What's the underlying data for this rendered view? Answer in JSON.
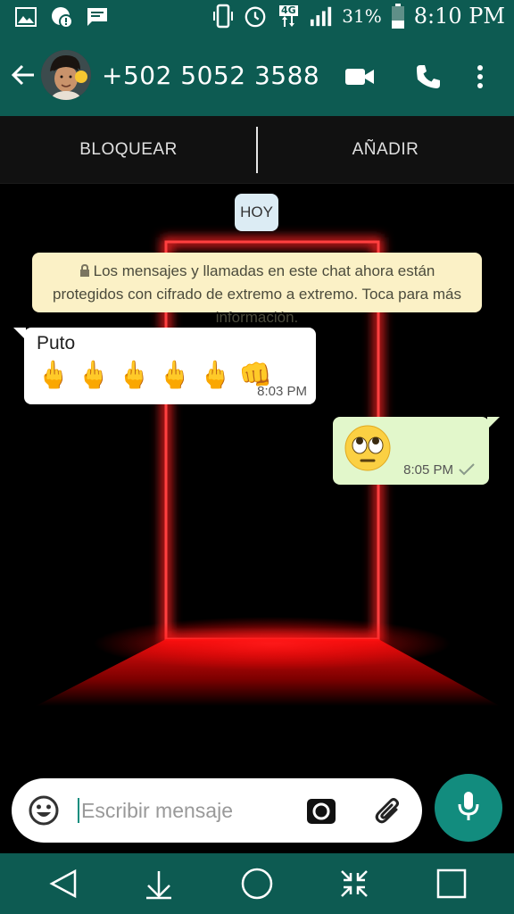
{
  "status_bar": {
    "network": "4G",
    "battery_percent": "31%",
    "time": "8:10 PM"
  },
  "header": {
    "contact_name": "+502 5052 3588",
    "back_icon": "arrow-left-icon",
    "video_icon": "videocam-icon",
    "call_icon": "phone-icon",
    "menu_icon": "more-vert-icon"
  },
  "actions": {
    "block_label": "BLOQUEAR",
    "add_label": "AÑADIR"
  },
  "chat": {
    "day_label": "HOY",
    "encryption_notice": "Los mensajes y llamadas en este chat ahora están protegidos con cifrado de extremo a extremo. Toca para más información.",
    "messages": [
      {
        "direction": "incoming",
        "text": "Puto",
        "emojis": [
          "🖕",
          "🖕",
          "🖕",
          "🖕",
          "🖕",
          "👊"
        ],
        "time": "8:03 PM"
      },
      {
        "direction": "outgoing",
        "emoji": "🙄",
        "time": "8:05 PM",
        "status": "sent"
      }
    ]
  },
  "composer": {
    "placeholder": "Escribir mensaje"
  },
  "colors": {
    "primary": "#0d5b52",
    "accent": "#128c7e",
    "incoming_bubble": "#ffffff",
    "outgoing_bubble": "#e2f7cb",
    "notice_bg": "#fbf1c6"
  }
}
